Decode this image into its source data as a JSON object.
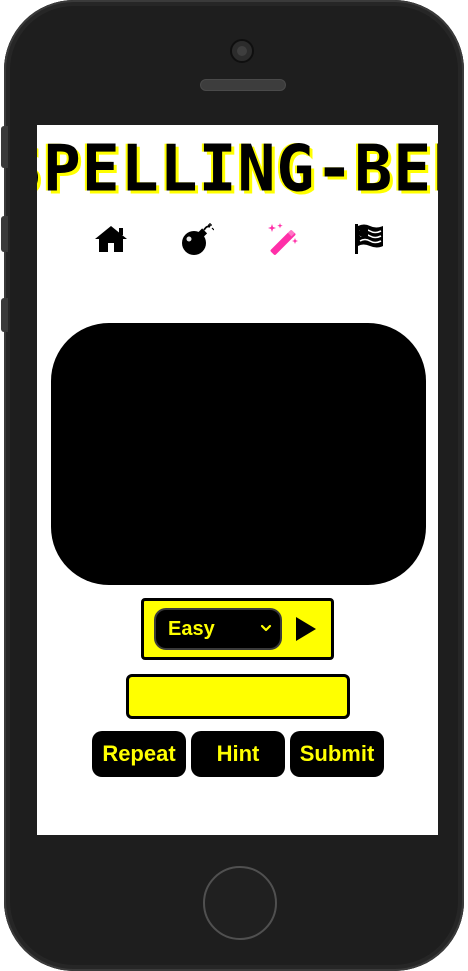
{
  "app": {
    "title": "SPELLING-BEE"
  },
  "nav": {
    "items": [
      {
        "icon": "home-icon",
        "active": false
      },
      {
        "icon": "bomb-icon",
        "active": false
      },
      {
        "icon": "magic-wand-icon",
        "active": true
      },
      {
        "icon": "flag-icon",
        "active": false
      }
    ],
    "active_color": "#ff2fa8",
    "color": "#000000"
  },
  "game": {
    "word_display": "",
    "level": {
      "selected": "Easy"
    },
    "play_icon": "play-icon",
    "answer": {
      "value": "",
      "placeholder": ""
    },
    "buttons": {
      "repeat": "Repeat",
      "hint": "Hint",
      "submit": "Submit"
    }
  },
  "colors": {
    "accent": "#ffff00",
    "dark": "#000000",
    "frame": "#1e1e1e"
  }
}
